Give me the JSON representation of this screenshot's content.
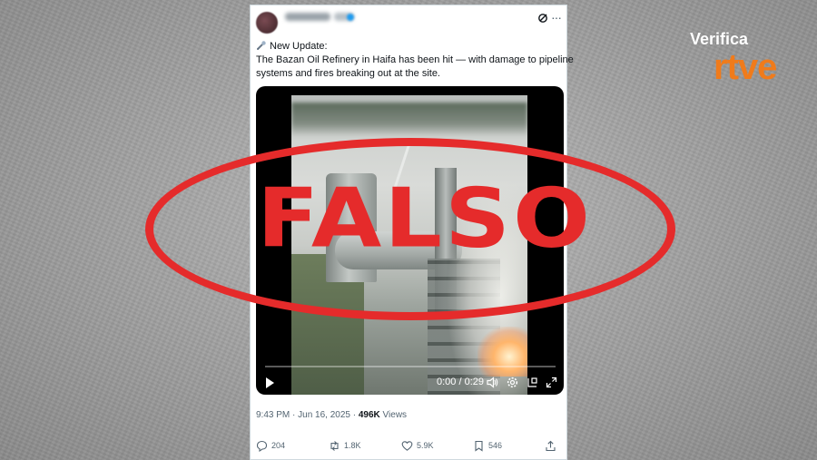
{
  "tweet": {
    "text_lines": [
      "New Update:",
      "The Bazan Oil Refinery in Haifa has been hit — with damage to pipeline",
      "systems and fires breaking out at the site."
    ],
    "video": {
      "time": "0:00 / 0:29",
      "progress": 0.0
    },
    "timestamp": "9:43 PM · Jun 16, 2025",
    "views_count": "496K",
    "views_label": "Views",
    "actions": {
      "replies": "204",
      "reposts": "1.8K",
      "likes": "5.9K",
      "bookmarks": "546"
    }
  },
  "stamp": {
    "label": "FALSO",
    "color": "#e52b2b"
  },
  "logo": {
    "verifica": "Verifica",
    "rtve": "rtve",
    "color_rtve": "#f07b1b"
  },
  "icons": {
    "update": "wrench-tool-icon",
    "grok": "grok-icon",
    "more": "more-horizontal-icon",
    "reply": "reply-icon",
    "repost": "repost-icon",
    "like": "heart-icon",
    "bookmark": "bookmark-icon",
    "share": "share-icon",
    "play": "play-icon",
    "volume": "volume-icon",
    "settings": "settings-gear-icon",
    "pip": "picture-in-picture-icon",
    "fullscreen": "fullscreen-icon"
  }
}
